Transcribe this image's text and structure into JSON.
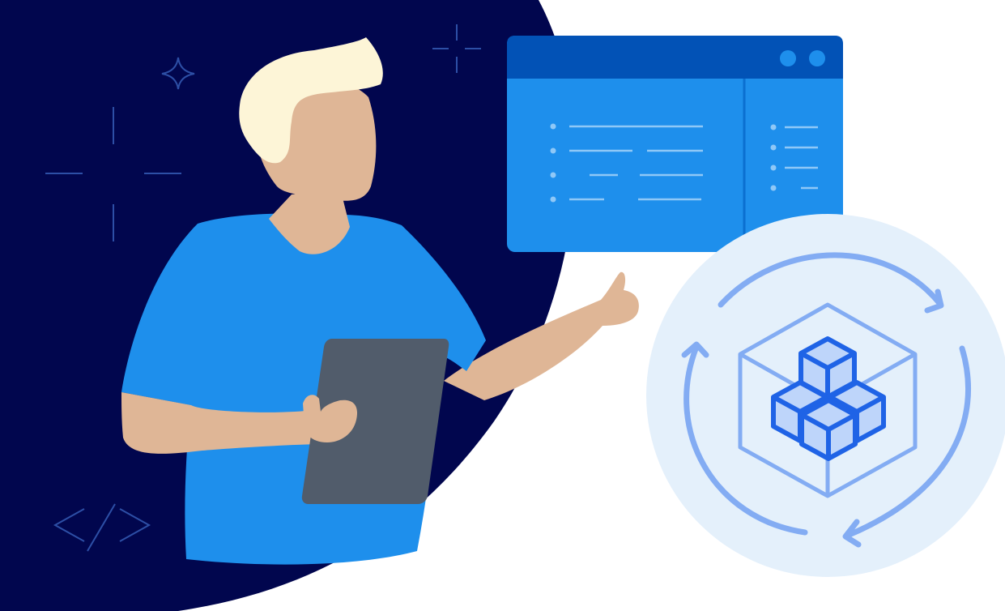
{
  "illustration": {
    "code_tag": "</>",
    "palette": {
      "night_background": "#01064e",
      "shirt_blue": "#1e8fec",
      "window_blue": "#1e8fec",
      "window_titlebar": "#0252b6",
      "window_lines": "#8fc8f7",
      "skin": "#dfb696",
      "hair": "#fdf5d7",
      "tablet_gray": "#515c6b",
      "circle_bg": "#e4f0fb",
      "cycle_arrows": "#83acf3",
      "cube_outline": "#83acf3",
      "cubes_stroke": "#1f63e6",
      "cubes_fill": "#bed5fa",
      "sparkle_lines": "#2d4fa6"
    },
    "icons": [
      "sparkle-icon",
      "crosshair-icon",
      "code-tag-icon",
      "window-control-dots",
      "cycle-arrows-icon",
      "cubes-icon"
    ]
  }
}
